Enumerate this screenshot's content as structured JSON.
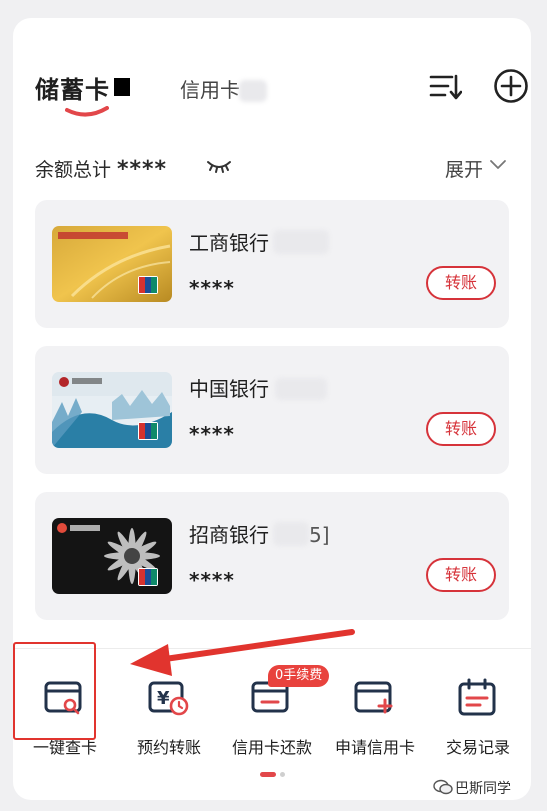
{
  "tabs": {
    "active": "储蓄卡",
    "inactive": "信用卡"
  },
  "balance": {
    "label": "余额总计",
    "value": "****",
    "expand_label": "展开"
  },
  "cards": [
    {
      "bank": "工商银行",
      "masked": "****",
      "action": "转账"
    },
    {
      "bank": "中国银行",
      "masked": "****",
      "action": "转账"
    },
    {
      "bank": "招商银行",
      "suffix": "5]",
      "masked": "****",
      "action": "转账"
    }
  ],
  "toolbar": {
    "items": [
      {
        "label": "一键查卡"
      },
      {
        "label": "预约转账"
      },
      {
        "label": "信用卡还款"
      },
      {
        "label": "申请信用卡"
      },
      {
        "label": "交易记录"
      }
    ],
    "fee_badge": "0手续费"
  },
  "watermark": "巴斯同学",
  "colors": {
    "accent_red": "#d6333a",
    "icon_blue": "#22324a"
  }
}
